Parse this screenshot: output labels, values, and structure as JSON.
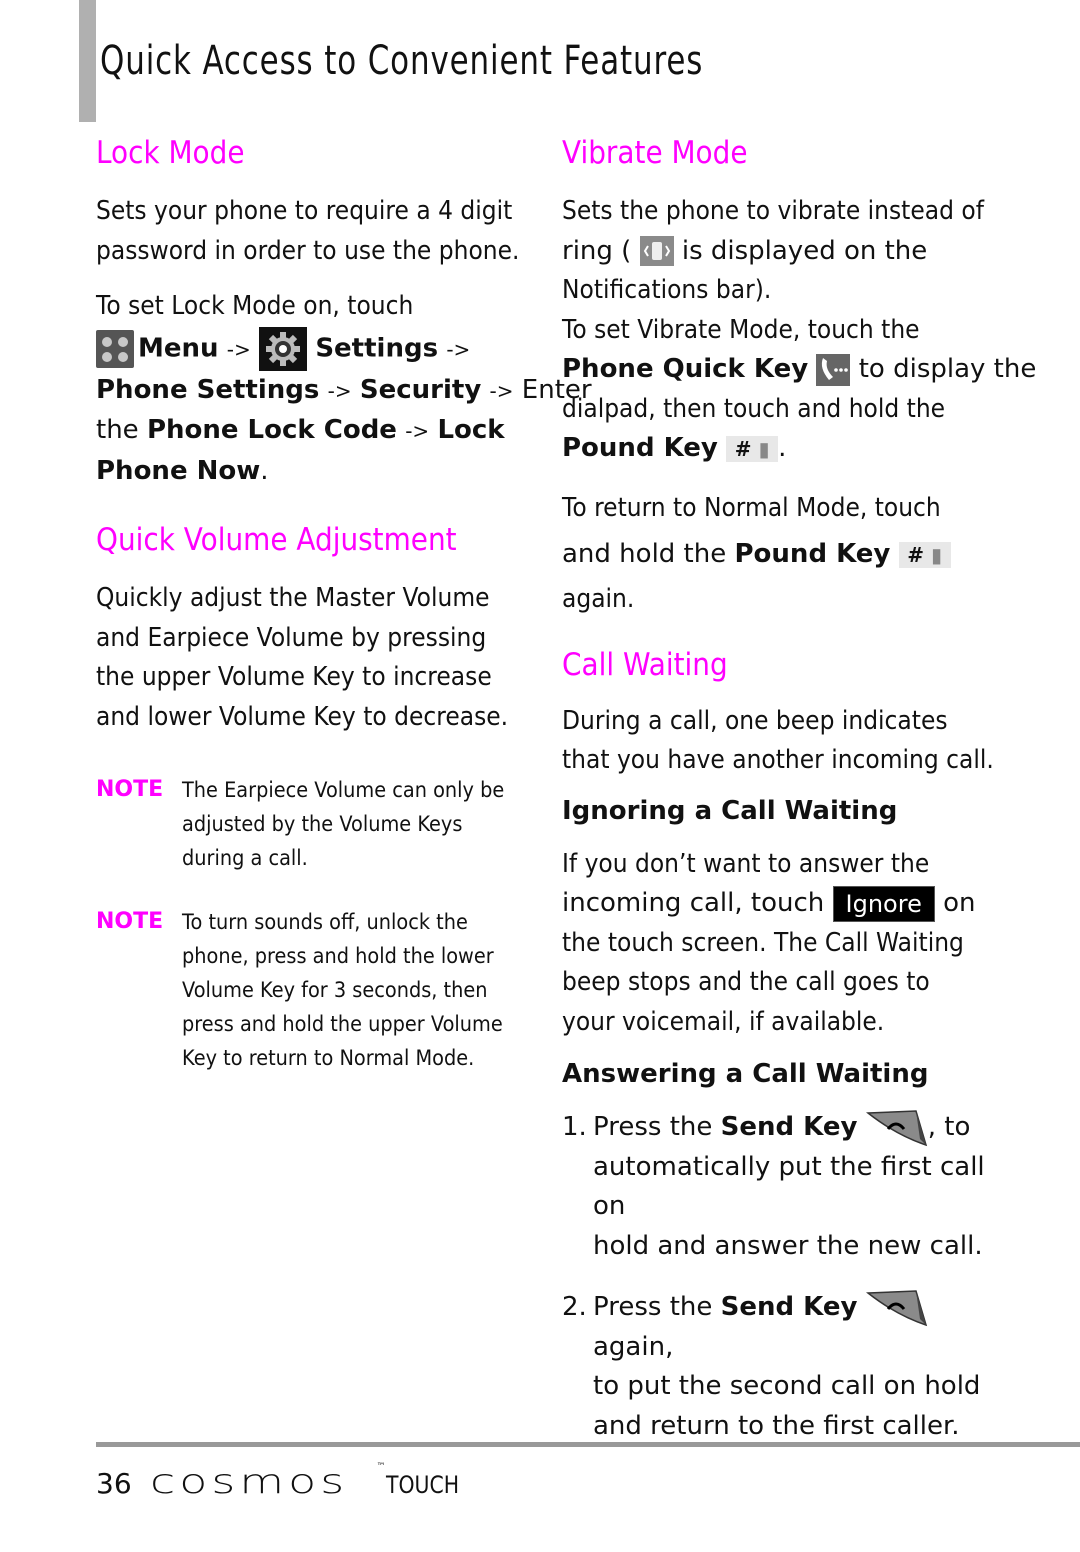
{
  "header": {
    "title": "Quick Access to Convenient Features"
  },
  "lock_mode": {
    "heading": "Lock Mode",
    "intro_line1": "Sets your phone to require a 4 digit",
    "intro_line2": "password in order to use the phone.",
    "steps_line1": "To set Lock Mode on, touch",
    "menu_label": "Menu",
    "arrow": "->",
    "settings_label": "Settings",
    "phone_settings": "Phone Settings",
    "security": "Security",
    "enter": "Enter",
    "the": "the",
    "phone_lock_code": "Phone Lock Code",
    "lock": "Lock",
    "phone_now": "Phone Now",
    "period": "."
  },
  "quick_volume": {
    "heading": "Quick Volume Adjustment",
    "lines": [
      "Quickly adjust the Master Volume",
      "and Earpiece Volume by pressing",
      "the upper Volume Key to increase",
      "and lower Volume Key to decrease."
    ],
    "notes": [
      {
        "label": "NOTE",
        "lines": [
          "The Earpiece Volume can only be",
          "adjusted by the Volume Keys",
          "during a call."
        ]
      },
      {
        "label": "NOTE",
        "lines": [
          "To turn sounds off, unlock the",
          "phone, press and hold the lower",
          "Volume Key for 3 seconds, then",
          "press and hold the upper Volume",
          "Key to return to Normal Mode."
        ]
      }
    ]
  },
  "vibrate_mode": {
    "heading": "Vibrate Mode",
    "line1": "Sets the phone to vibrate instead of",
    "line2_pre": "ring (",
    "line2_post": "is displayed on the",
    "line3": "Notifications bar).",
    "line4": "To set Vibrate Mode, touch the",
    "phone_quick_key": "Phone Quick Key",
    "line5_post": "to display the",
    "line6": "dialpad, then touch and hold the",
    "pound_key": "Pound Key",
    "pound_glyph": "#",
    "period": ".",
    "return_line1": "To return to Normal Mode, touch",
    "return_line2_pre": "and hold the",
    "return_line3": "again."
  },
  "call_waiting": {
    "heading": "Call Waiting",
    "intro_line1": "During a call, one beep indicates",
    "intro_line2": "that you have another incoming call.",
    "ignoring_heading": "Ignoring a Call Waiting",
    "ign_line1": "If you don’t want to answer the",
    "ign_line2_pre": "incoming call, touch",
    "ignore_button": "Ignore",
    "ign_line2_post": "on",
    "ign_line3": "the touch screen. The Call Waiting",
    "ign_line4": "beep stops and the call goes to",
    "ign_line5": "your voicemail, if available.",
    "answering_heading": "Answering a Call Waiting",
    "steps": [
      {
        "num": "1.",
        "pre": "Press the",
        "key": "Send Key",
        "post": ", to",
        "lines": [
          "automatically put the first call on",
          "hold and answer the new call."
        ]
      },
      {
        "num": "2.",
        "pre": "Press the",
        "key": "Send Key",
        "post": "again,",
        "lines": [
          "to put the second call on hold",
          "and return to the first caller."
        ]
      }
    ]
  },
  "footer": {
    "page_number": "36",
    "brand": "cosmos",
    "brand_tm": "™",
    "brand_suffix": "TOUCH"
  },
  "colors": {
    "heading_accent": "#ff00ff",
    "side_bar": "#b0b0b0",
    "footer_rule": "#999999"
  }
}
